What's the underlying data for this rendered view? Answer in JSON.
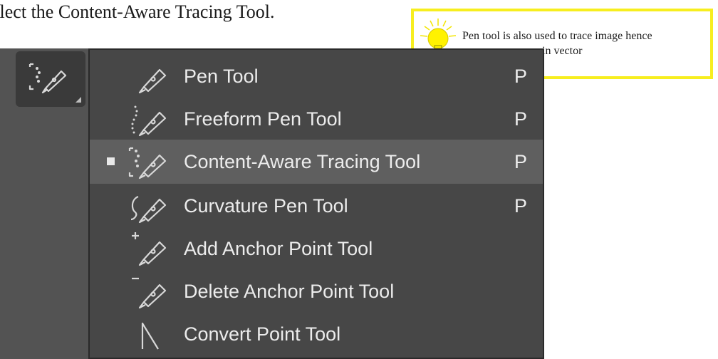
{
  "instruction": "elect the Content-Aware Tracing Tool.",
  "callout": {
    "line1": "Pen tool is also used to trace image hence",
    "line2": "in  vector",
    "icon": "lightbulb-icon"
  },
  "toolbar": {
    "active_tool_icon": "content-aware-tracing-icon"
  },
  "menu": {
    "items": [
      {
        "label": "Pen Tool",
        "shortcut": "P",
        "icon": "pen-icon",
        "selected": false
      },
      {
        "label": "Freeform Pen Tool",
        "shortcut": "P",
        "icon": "freeform-pen-icon",
        "selected": false
      },
      {
        "label": "Content-Aware Tracing Tool",
        "shortcut": "P",
        "icon": "content-aware-tracing-icon",
        "selected": true
      },
      {
        "label": "Curvature Pen Tool",
        "shortcut": "P",
        "icon": "curvature-pen-icon",
        "selected": false
      },
      {
        "label": "Add Anchor Point Tool",
        "shortcut": "",
        "icon": "add-anchor-point-icon",
        "selected": false
      },
      {
        "label": "Delete Anchor Point Tool",
        "shortcut": "",
        "icon": "delete-anchor-point-icon",
        "selected": false
      },
      {
        "label": "Convert Point Tool",
        "shortcut": "",
        "icon": "convert-point-icon",
        "selected": false
      }
    ]
  },
  "colors": {
    "menu_bg": "#474747",
    "menu_selected_bg": "#5f5f5f",
    "toolbar_bg": "#535353",
    "callout_border": "#f7ee1f",
    "text": "#ececec"
  }
}
